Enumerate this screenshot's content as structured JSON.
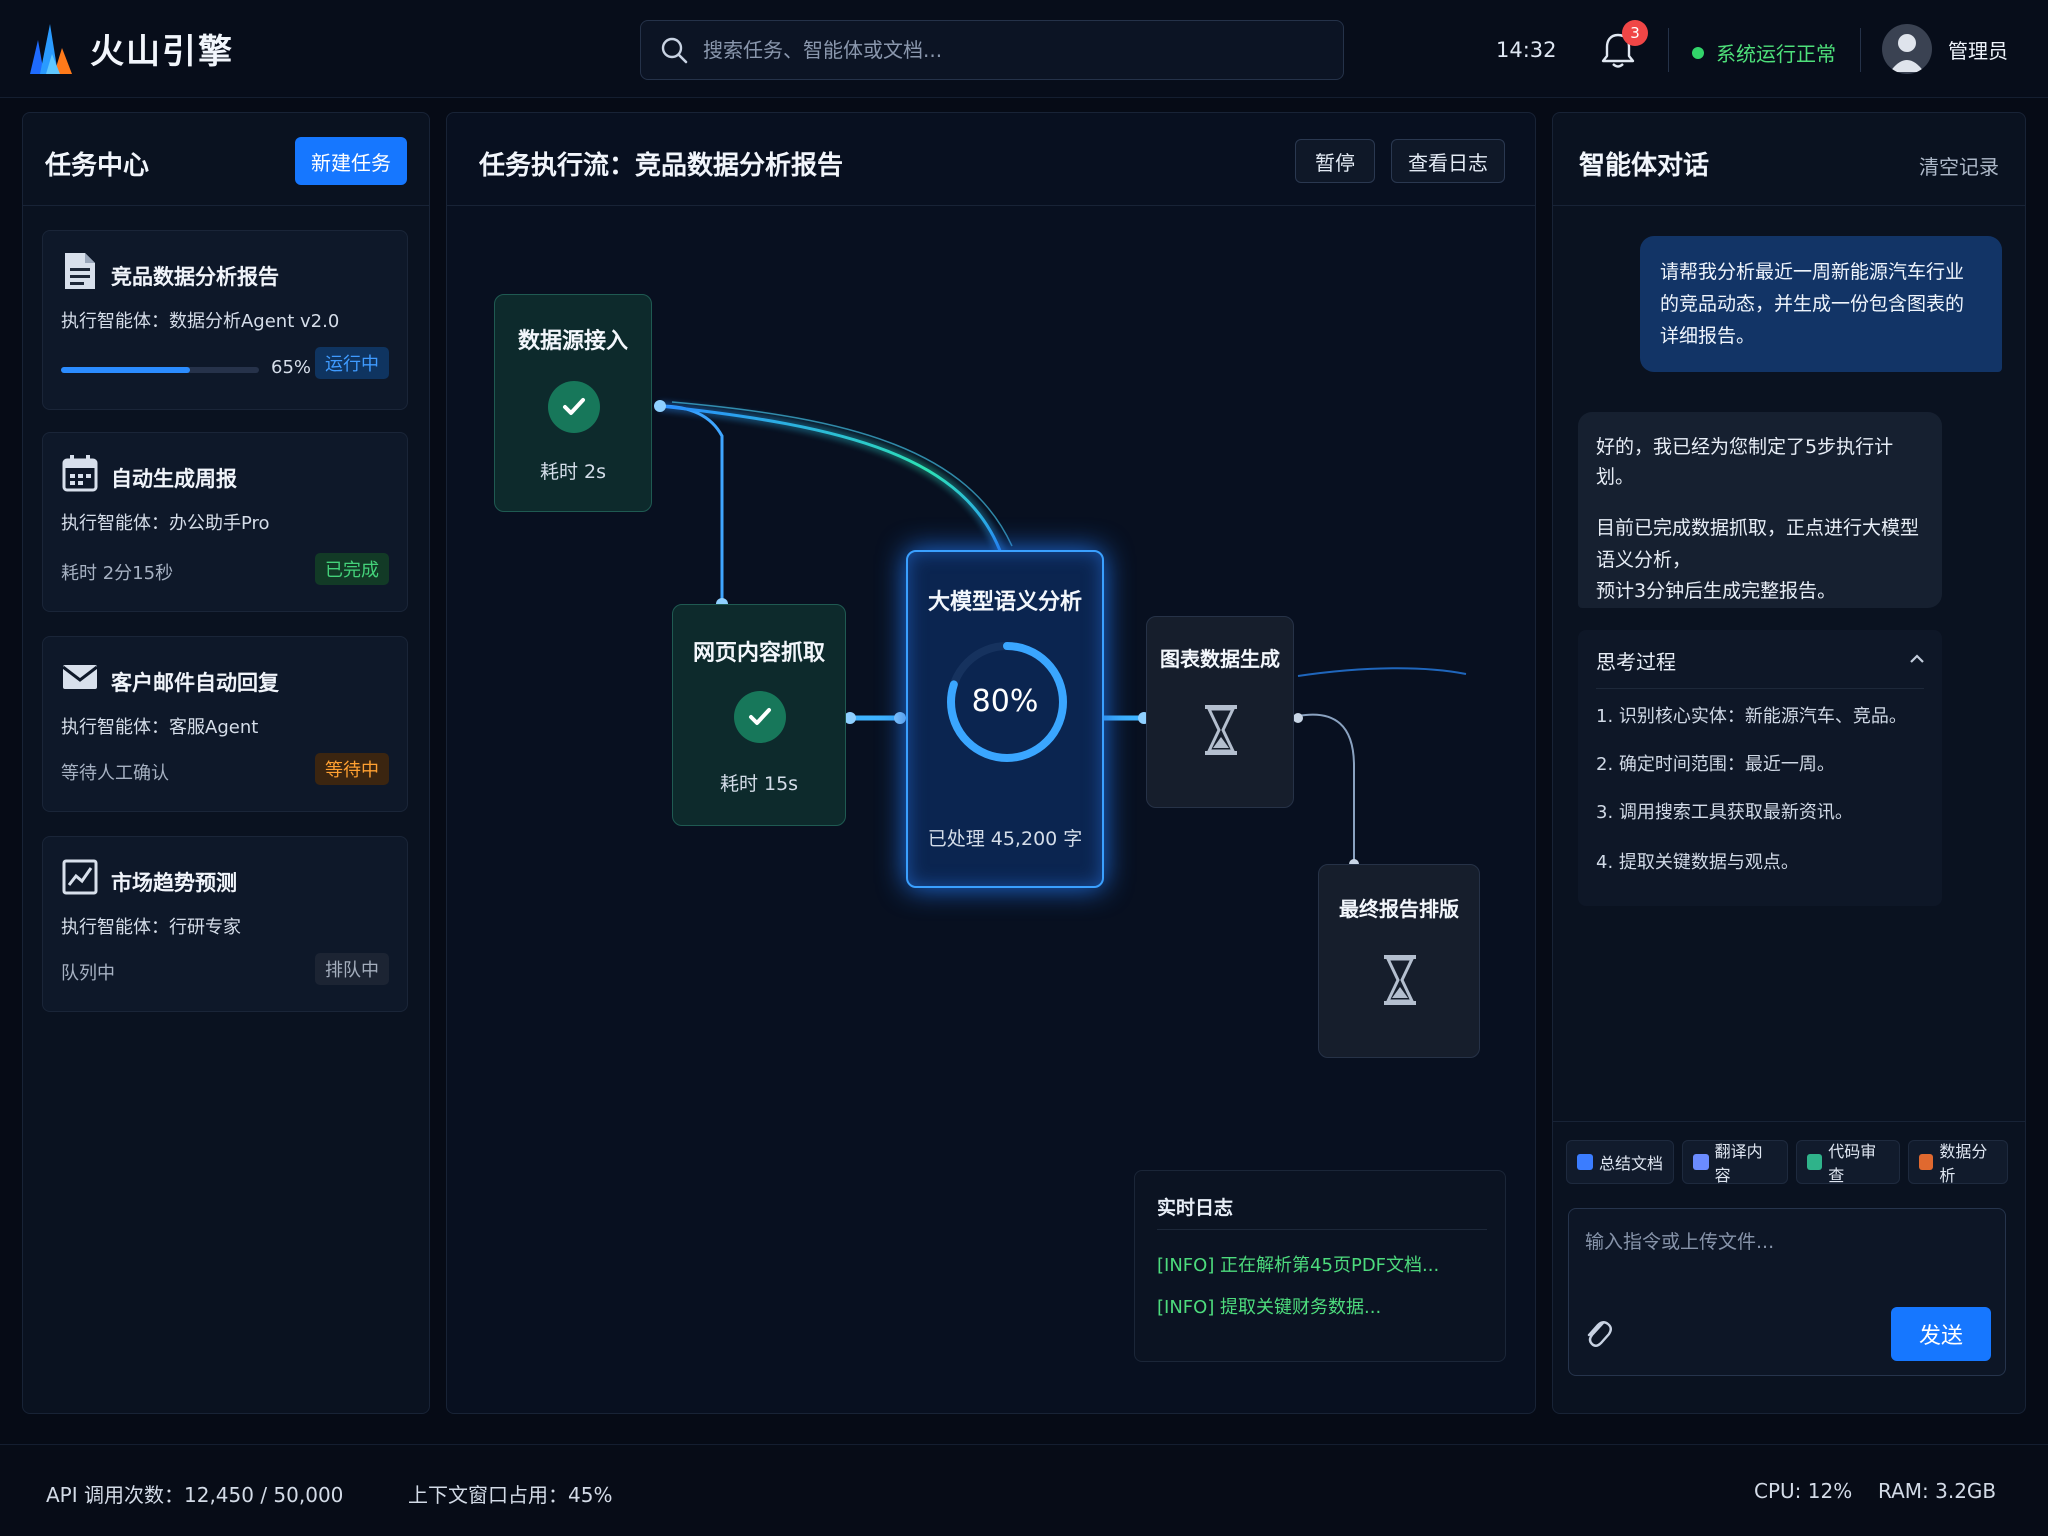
{
  "header": {
    "brand": "火山引擎",
    "search_placeholder": "搜索任务、智能体或文档...",
    "time": "14:32",
    "notification_count": "3",
    "system_status": "系统运行正常",
    "user_name": "管理员",
    "colors": {
      "accent": "#1677ff",
      "status_ok": "#32d46a",
      "badge": "#f04646"
    }
  },
  "task_center": {
    "title": "任务中心",
    "new_task_label": "新建任务",
    "tasks": [
      {
        "icon": "document-icon",
        "name": "竞品数据分析报告",
        "agent": "执行智能体：数据分析Agent v2.0",
        "progress": 0.65,
        "progress_text": "65%",
        "status": "运行中"
      },
      {
        "icon": "calendar-icon",
        "name": "自动生成周报",
        "agent": "执行智能体：办公助手Pro",
        "meta": "耗时 2分15秒",
        "status": "已完成"
      },
      {
        "icon": "mail-icon",
        "name": "客户邮件自动回复",
        "agent": "执行智能体：客服Agent",
        "meta": "等待人工确认",
        "status": "等待中"
      },
      {
        "icon": "chart-line-icon",
        "name": "市场趋势预测",
        "agent": "执行智能体：行研专家",
        "meta": "队列中",
        "status": "排队中"
      }
    ]
  },
  "flow": {
    "title": "任务执行流：竞品数据分析报告",
    "pause_label": "暂停",
    "view_log_label": "查看日志",
    "nodes": {
      "source": {
        "title": "数据源接入",
        "sub": "耗时 2s",
        "state": "done"
      },
      "crawl": {
        "title": "网页内容抓取",
        "sub": "耗时 15s",
        "state": "done"
      },
      "llm": {
        "title": "大模型语义分析",
        "percent": 80,
        "percent_text": "80%",
        "sub": "已处理 45,200 字",
        "state": "running"
      },
      "chart": {
        "title": "图表数据生成",
        "state": "pending"
      },
      "report": {
        "title": "最终报告排版",
        "state": "pending"
      }
    },
    "log": {
      "title": "实时日志",
      "lines": [
        "[INFO] 正在解析第45页PDF文档...",
        "[INFO] 提取关键财务数据..."
      ]
    }
  },
  "chat": {
    "title": "智能体对话",
    "clear_label": "清空记录",
    "user_message": "请帮我分析最近一周新能源汽车行业的竞品动态，并生成一份包含图表的详细报告。",
    "ai_lines": [
      "好的，我已经为您制定了5步执行计划。",
      "目前已完成数据抓取，正点进行大模型语义分析，",
      "预计3分钟后生成完整报告。"
    ],
    "thinking_title": "思考过程",
    "thinking_steps": [
      "1. 识别核心实体：新能源汽车、竞品。",
      "2. 确定时间范围：最近一周。",
      "3. 调用搜索工具获取最新资讯。",
      "4. 提取关键数据与观点。"
    ],
    "quick_actions": [
      "总结文档",
      "翻译内容",
      "代码审查",
      "数据分析"
    ],
    "input_placeholder": "输入指令或上传文件...",
    "send_label": "发送"
  },
  "footer": {
    "api_calls": "API 调用次数：12,450 / 50,000",
    "context_usage": "上下文窗口占用：45%",
    "cpu": "CPU: 12%",
    "ram": "RAM: 3.2GB"
  }
}
